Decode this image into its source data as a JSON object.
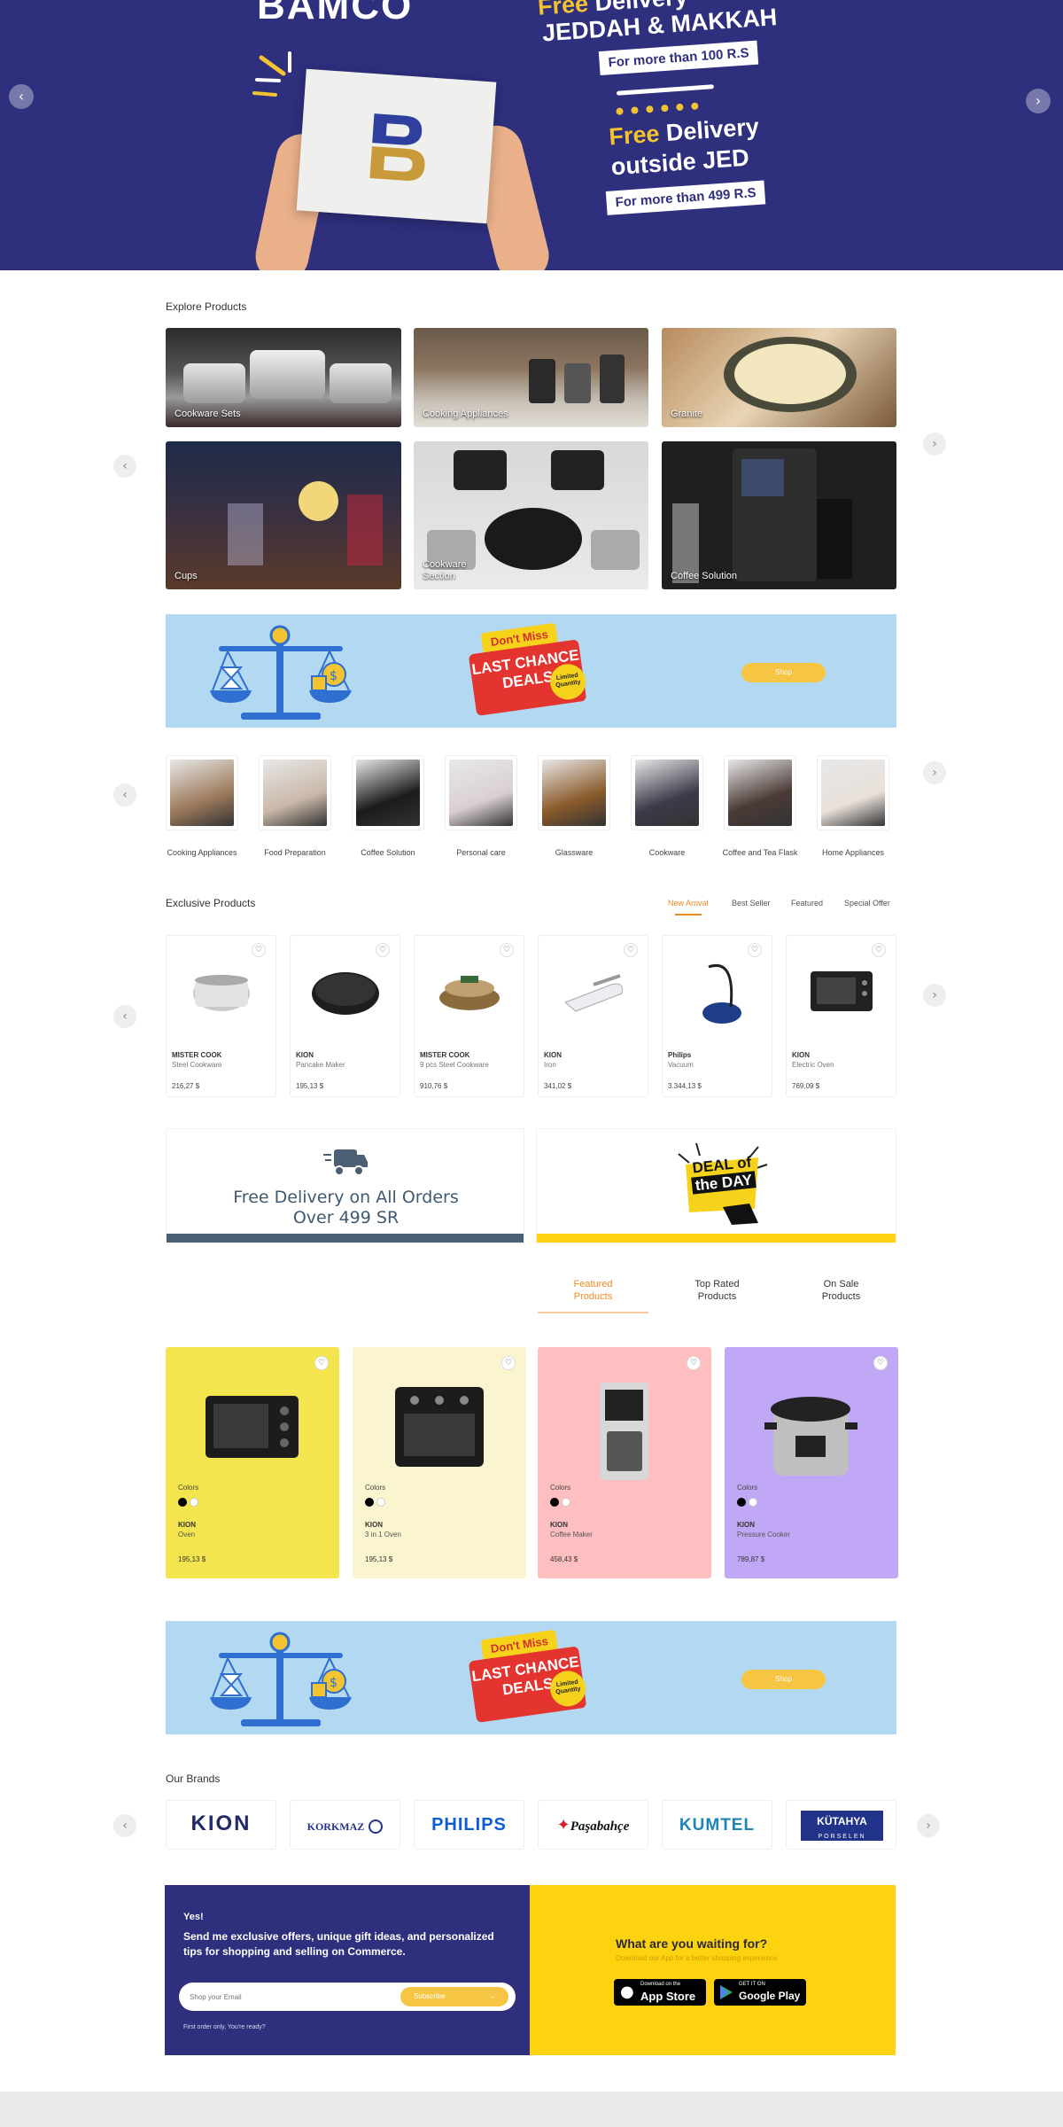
{
  "hero": {
    "logo": "BAMCO",
    "line1_free": "Free",
    "line1_rest": "Delivery",
    "line2": "JEDDAH &  MAKKAH",
    "box1": "For more than 100 R.S",
    "line3_free": "Free",
    "line3_rest": "Delivery",
    "line4": "outside JED",
    "box2": "For more than 499 R.S",
    "prev_icon": "‹",
    "next_icon": "›"
  },
  "explore": {
    "title": "Explore Products",
    "tiles": [
      {
        "label": "Cookware Sets"
      },
      {
        "label": "Cooking Appliances"
      },
      {
        "label": "Granite"
      },
      {
        "label": "Cups"
      },
      {
        "label": "Cookware Section"
      },
      {
        "label": "Coffee Solution"
      }
    ]
  },
  "deals_banner": {
    "tag": "Don't Miss",
    "main_line1": "LAST CHANCE",
    "main_line2": "DEALS",
    "seal": "Limited Quantity",
    "button": "Shop"
  },
  "categories": [
    {
      "label": "Cooking Appliances",
      "color": "#9c7a5c"
    },
    {
      "label": "Food Preparation",
      "color": "#c9b8a8"
    },
    {
      "label": "Coffee Solution",
      "color": "#1b1b1b"
    },
    {
      "label": "Personal care",
      "color": "#d9cfd3"
    },
    {
      "label": "Glassware",
      "color": "#8a5a2b"
    },
    {
      "label": "Cookware",
      "color": "#3b3b4a"
    },
    {
      "label": "Coffee and Tea Flask",
      "color": "#4a3a36"
    },
    {
      "label": "Home Appliances",
      "color": "#e8e0da"
    }
  ],
  "exclusive": {
    "title": "Exclusive Products",
    "tabs": [
      "New Arrival",
      "Best Seller",
      "Featured",
      "Special Offer"
    ],
    "heart_icon": "♡",
    "products": [
      {
        "brand": "MISTER COOK",
        "name": "Steel Cookware",
        "price": "216,27 $"
      },
      {
        "brand": "KION",
        "name": "Pancake Maker",
        "price": "195,13 $"
      },
      {
        "brand": "MISTER COOK",
        "name": "9 pcs Steel Cookware",
        "price": "910,76 $"
      },
      {
        "brand": "KION",
        "name": "Iron",
        "price": "341,02 $"
      },
      {
        "brand": "Philips",
        "name": "Vacuum",
        "price": "3.344,13 $"
      },
      {
        "brand": "KION",
        "name": "Electric Oven",
        "price": "769,09 $"
      }
    ]
  },
  "promos": {
    "free_line1": "Free Delivery on All Orders",
    "free_line2": "Over 499 SR",
    "deal_line1": "DEAL of",
    "deal_line2": "the DAY"
  },
  "featured": {
    "tabs": [
      {
        "l1": "Featured",
        "l2": "Products"
      },
      {
        "l1": "Top Rated",
        "l2": "Products"
      },
      {
        "l1": "On Sale",
        "l2": "Products"
      }
    ],
    "colors_label": "Colors",
    "cards": [
      {
        "brand": "KION",
        "name": "Oven",
        "price": "195,13 $",
        "bg": "#f4e44e"
      },
      {
        "brand": "KION",
        "name": "3 in 1 Oven",
        "price": "195,13 $",
        "bg": "#faf5cf"
      },
      {
        "brand": "KION",
        "name": "Coffee Maker",
        "price": "458,43 $",
        "bg": "#ffbfc1"
      },
      {
        "brand": "KION",
        "name": "Pressure Cooker",
        "price": "789,87 $",
        "bg": "#c1a8f7"
      }
    ]
  },
  "brands": {
    "title": "Our Brands",
    "items": [
      "KION",
      "KORKMAZ",
      "PHILIPS",
      "Paşabahçe",
      "KUMTEL",
      "KÜTAHYA"
    ],
    "kutahya_sub": "PORSELEN"
  },
  "newsletter": {
    "yes": "Yes!",
    "text": "Send me exclusive offers, unique gift ideas, and personalized tips for shopping and selling on Commerce.",
    "placeholder": "Shop your Email",
    "button": "Subscribe",
    "note": "First order only, You're ready?"
  },
  "app": {
    "title": "What are you waiting for?",
    "subtitle": "Download our App for a better shopping experience",
    "appstore_small": "Download on the",
    "appstore_big": "App Store",
    "gplay_small": "GET IT ON",
    "gplay_big": "Google Play"
  }
}
